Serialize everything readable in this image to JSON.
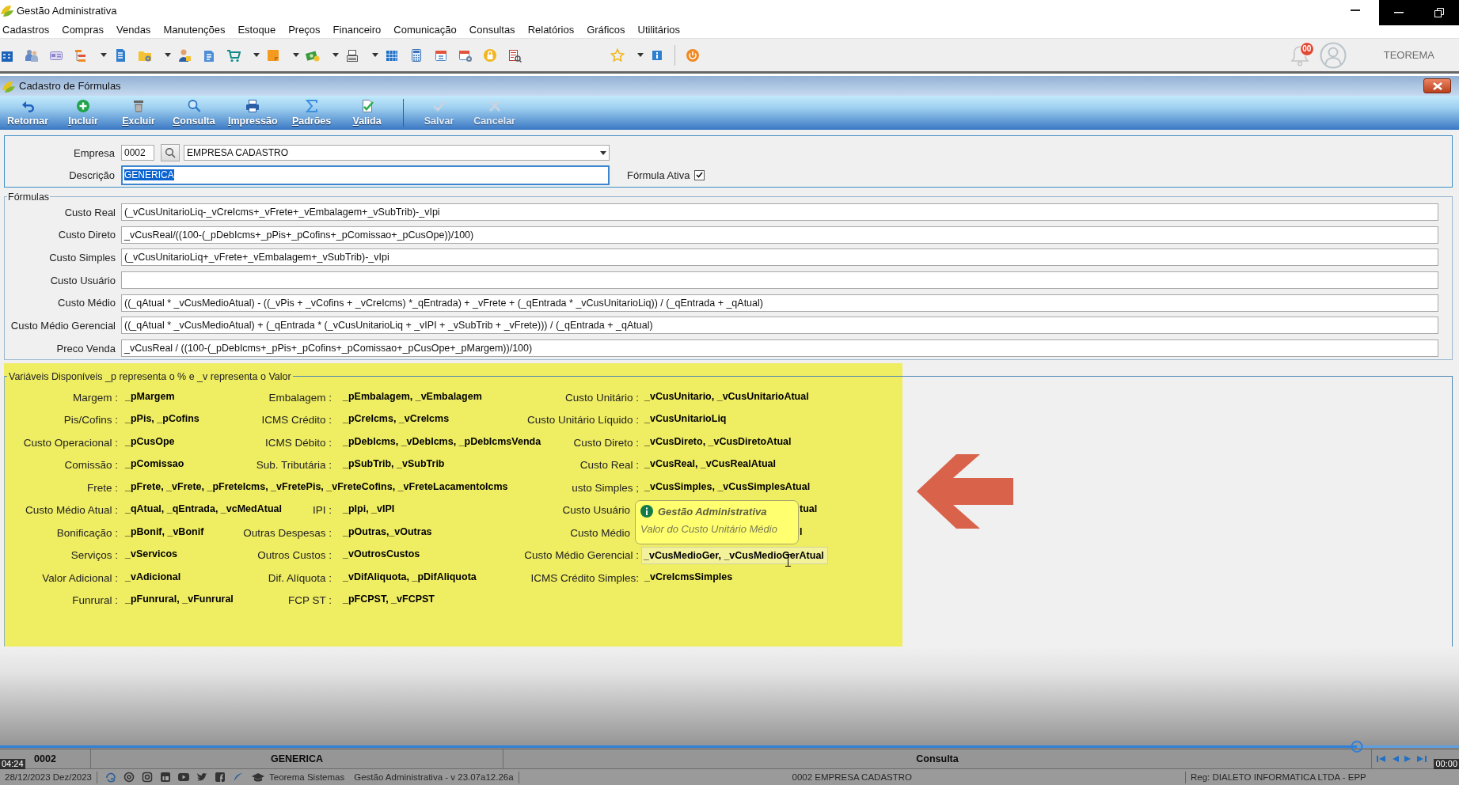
{
  "window": {
    "title": "Gestão Administrativa"
  },
  "menu": [
    "Cadastros",
    "Compras",
    "Vendas",
    "Manutenções",
    "Estoque",
    "Preços",
    "Financeiro",
    "Comunicação",
    "Consultas",
    "Relatórios",
    "Gráficos",
    "Utilitários"
  ],
  "toolbar": {
    "notifications": "00",
    "user": "TEOREMA"
  },
  "form": {
    "title": "Cadastro de Fórmulas",
    "actions": [
      {
        "label": "Retornar",
        "shortcut": false,
        "disabled": false
      },
      {
        "label": "Incluir",
        "shortcut": true,
        "disabled": false
      },
      {
        "label": "Excluir",
        "shortcut": true,
        "disabled": false
      },
      {
        "label": "Consulta",
        "shortcut": true,
        "disabled": false
      },
      {
        "label": "Impressão",
        "shortcut": true,
        "disabled": false
      },
      {
        "label": "Padrões",
        "shortcut": true,
        "disabled": false
      },
      {
        "label": "Valida",
        "shortcut": true,
        "disabled": false
      },
      {
        "label": "Salvar",
        "shortcut": false,
        "disabled": true
      },
      {
        "label": "Cancelar",
        "shortcut": false,
        "disabled": true
      }
    ],
    "empresa": {
      "label": "Empresa",
      "code": "0002",
      "name": "EMPRESA CADASTRO"
    },
    "descricao": {
      "label": "Descrição",
      "value": "GENERICA",
      "focused": true
    },
    "ativa": {
      "label": "Fórmula Ativa",
      "checked": true
    },
    "formulas": {
      "title": "Fórmulas",
      "rows": [
        {
          "label": "Custo Real",
          "value": "(_vCusUnitarioLiq-_vCreIcms+_vFrete+_vEmbalagem+_vSubTrib)-_vIpi"
        },
        {
          "label": "Custo Direto",
          "value": "_vCusReal/((100-(_pDebIcms+_pPis+_pCofins+_pComissao+_pCusOpe))/100)"
        },
        {
          "label": "Custo Simples",
          "value": "(_vCusUnitarioLiq+_vFrete+_vEmbalagem+_vSubTrib)-_vIpi"
        },
        {
          "label": "Custo Usuário"
        },
        {
          "label": "Custo Médio",
          "value": "((_qAtual * _vCusMedioAtual) - ((_vPis + _vCofins + _vCreIcms) *_qEntrada) + _vFrete + (_qEntrada * _vCusUnitarioLiq)) / (_qEntrada + _qAtual)"
        },
        {
          "label": "Custo Médio Gerencial",
          "value": "((_qAtual * _vCusMedioAtual) + (_qEntrada * (_vCusUnitarioLiq + _vIPI + _vSubTrib + _vFrete))) / (_qEntrada + _qAtual)"
        },
        {
          "label": "Preco Venda",
          "value": "_vCusReal / ((100-(_pDebIcms+_pPis+_pCofins+_pComissao+_pCusOpe+_pMargem))/100)"
        }
      ]
    },
    "variables": {
      "title": "Variáveis Disponíveis _p representa o % e _v representa o Valor",
      "rows": [
        [
          {
            "label": "Margem :",
            "value": "_pMargem",
            "kind": "normal"
          },
          {
            "label": "Embalagem :",
            "value": "_pEmbalagem, _vEmbalagem",
            "kind": "normal"
          },
          {
            "label": "Custo Unitário :",
            "value": "_vCusUnitario, _vCusUnitarioAtual",
            "kind": "normal"
          }
        ],
        [
          {
            "label": "Pis/Cofins :",
            "value": "_pPis, _pCofins",
            "kind": "normal"
          },
          {
            "label": "ICMS Crédito :",
            "value": "_pCreIcms, _vCreIcms",
            "kind": "normal"
          },
          {
            "label": "Custo Unitário Líquido :",
            "value": "_vCusUnitarioLiq",
            "kind": "normal"
          }
        ],
        [
          {
            "label": "Custo Operacional :",
            "value": "_pCusOpe",
            "kind": "normal"
          },
          {
            "label": "ICMS Débito :",
            "value": "_pDebIcms, _vDebIcms, _pDebIcmsVenda",
            "kind": "normal"
          },
          {
            "label": "Custo Direto :",
            "value": "_vCusDireto, _vCusDiretoAtual",
            "kind": "normal"
          }
        ],
        [
          {
            "label": "Comissão :",
            "value": "_pComissao",
            "kind": "normal"
          },
          {
            "label": "Sub. Tributária :",
            "value": "_pSubTrib, _vSubTrib",
            "kind": "normal"
          },
          {
            "label": "Custo Real :",
            "value": "_vCusReal, _vCusRealAtual",
            "kind": "normal"
          }
        ],
        [
          {
            "label": "Frete :",
            "value": "_pFrete, _vFrete, _pFreteIcms, _vFretePis, _vFreteCofins, _vFreteLacamentoIcms",
            "kind": "normal"
          },
          "",
          {
            "label": "usto Simples ;",
            "value": "_vCusSimples, _vCusSimplesAtual",
            "kind": "normal"
          }
        ],
        [
          {
            "label": "Custo Médio Atual :",
            "value": "_qAtual, _qEntrada, _vcMedAtual",
            "kind": "normal"
          },
          {
            "label": "IPI :",
            "value": "_pIpi, _vIPI",
            "kind": "normal"
          },
          {
            "label": "Custo Usuário",
            "value": "tual",
            "kind": "covered"
          }
        ],
        [
          {
            "label": "Bonificação :",
            "value": "_pBonif, _vBonif",
            "kind": "normal"
          },
          {
            "label": "Outras Despesas :",
            "value": "_pOutras,_vOutras",
            "kind": "normal"
          },
          {
            "label": "Custo Médio",
            "value": "l",
            "kind": "covered"
          }
        ],
        [
          {
            "label": "Serviços :",
            "value": "_vServicos",
            "kind": "normal"
          },
          {
            "label": "Outros Custos :",
            "value": "_vOutrosCustos",
            "kind": "normal"
          },
          {
            "label": "Custo Médio Gerencial :",
            "value": "_vCusMedioGer, _vCusMedioGerAtual",
            "kind": "hovered"
          }
        ],
        [
          {
            "label": "Valor Adicional :",
            "value": "_vAdicional",
            "kind": "normal"
          },
          {
            "label": "Dif. Alíquota :",
            "value": "_vDifAliquota, _pDifAliquota",
            "kind": "normal"
          },
          {
            "label": "ICMS Crédito Simples:",
            "value": "_vCreIcmsSimples",
            "kind": "normal"
          }
        ],
        [
          {
            "label": "Funrural :",
            "value": "_pFunrural, _vFunrural",
            "kind": "normal"
          },
          {
            "label": "FCP ST :",
            "value": "_pFCPST, _vFCPST",
            "kind": "normal"
          }
        ]
      ]
    },
    "tooltip": {
      "title": "Gestão Administrativa",
      "text": "Valor do Custo Unitário Médio"
    }
  },
  "status_bar": {
    "code": "0002",
    "description": "GENERICA",
    "mode": "Consulta"
  },
  "video": {
    "elapsed": "04:24",
    "remaining": "00:00",
    "level": 0.93
  },
  "footer": {
    "date": "28/12/2023 Dez/2023",
    "company": "Teorema Sistemas",
    "version": "Gestão Administrativa - v 23.07a12.26a",
    "empresa": "0002 EMPRESA CADASTRO",
    "license": "Reg: DIALETO INFORMATICA LTDA - EPP"
  }
}
